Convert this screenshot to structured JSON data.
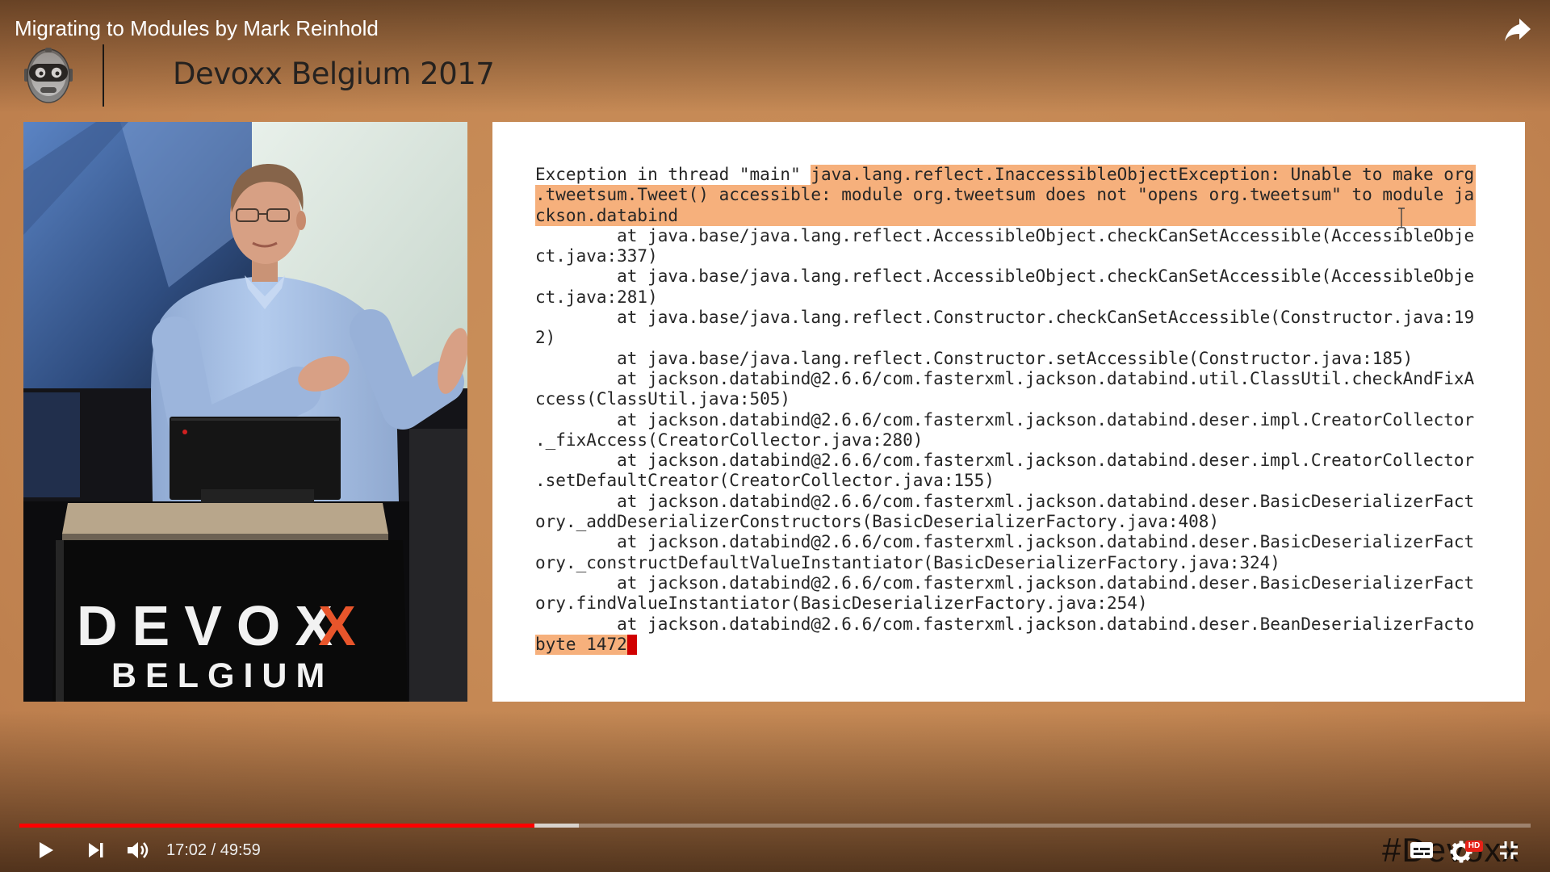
{
  "window": {
    "title": "Migrating to Modules by Mark Reinhold"
  },
  "header": {
    "event_title": "Devoxx Belgium 2017",
    "logo_icon": "devoxx-robot-logo"
  },
  "speaker_video": {
    "podium_brand": "DEVOX",
    "podium_brand_accent": "X",
    "podium_location": "BELGIUM"
  },
  "slide": {
    "lines": [
      {
        "plain": "Exception in thread \"main\" ",
        "hl": "java.lang.reflect.InaccessibleObjectException: Unable to make org"
      },
      {
        "hl": ".tweetsum.Tweet() accessible: module org.tweetsum does not \"opens org.tweetsum\" to module ja"
      },
      {
        "hl": "ckson.databind"
      },
      {
        "plain": "        at java.base/java.lang.reflect.AccessibleObject.checkCanSetAccessible(AccessibleObje"
      },
      {
        "plain": "ct.java:337)"
      },
      {
        "plain": "        at java.base/java.lang.reflect.AccessibleObject.checkCanSetAccessible(AccessibleObje"
      },
      {
        "plain": "ct.java:281)"
      },
      {
        "plain": "        at java.base/java.lang.reflect.Constructor.checkCanSetAccessible(Constructor.java:19"
      },
      {
        "plain": "2)"
      },
      {
        "plain": "        at java.base/java.lang.reflect.Constructor.setAccessible(Constructor.java:185)"
      },
      {
        "plain": "        at jackson.databind@2.6.6/com.fasterxml.jackson.databind.util.ClassUtil.checkAndFixA"
      },
      {
        "plain": "ccess(ClassUtil.java:505)"
      },
      {
        "plain": "        at jackson.databind@2.6.6/com.fasterxml.jackson.databind.deser.impl.CreatorCollector"
      },
      {
        "plain": "._fixAccess(CreatorCollector.java:280)"
      },
      {
        "plain": "        at jackson.databind@2.6.6/com.fasterxml.jackson.databind.deser.impl.CreatorCollector"
      },
      {
        "plain": ".setDefaultCreator(CreatorCollector.java:155)"
      },
      {
        "plain": "        at jackson.databind@2.6.6/com.fasterxml.jackson.databind.deser.BasicDeserializerFact"
      },
      {
        "plain": "ory._addDeserializerConstructors(BasicDeserializerFactory.java:408)"
      },
      {
        "plain": "        at jackson.databind@2.6.6/com.fasterxml.jackson.databind.deser.BasicDeserializerFact"
      },
      {
        "plain": "ory._constructDefaultValueInstantiator(BasicDeserializerFactory.java:324)"
      },
      {
        "plain": "        at jackson.databind@2.6.6/com.fasterxml.jackson.databind.deser.BasicDeserializerFact"
      },
      {
        "plain": "ory.findValueInstantiator(BasicDeserializerFactory.java:254)"
      },
      {
        "plain": "        at jackson.databind@2.6.6/com.fasterxml.jackson.databind.deser.BeanDeserializerFacto"
      },
      {
        "hl": "byte 1472",
        "cursor": true
      }
    ]
  },
  "player": {
    "current_time": "17:02",
    "time_separator": " / ",
    "duration": "49:59",
    "progress_played": 0.341,
    "progress_buffered": 0.37,
    "watermark": "#Devoxx",
    "hd_badge": "HD",
    "icons": {
      "play": "play-icon",
      "next": "next-icon",
      "volume": "volume-icon",
      "subtitles": "subtitles-icon",
      "settings": "settings-icon",
      "exit_fullscreen": "exit-fullscreen-icon",
      "share": "share-icon"
    }
  },
  "colors": {
    "background": "#c48753",
    "progress_played": "#ff0000",
    "highlight": "#f6b07c",
    "cursor": "#d00000",
    "brand_accent": "#e8552b"
  }
}
